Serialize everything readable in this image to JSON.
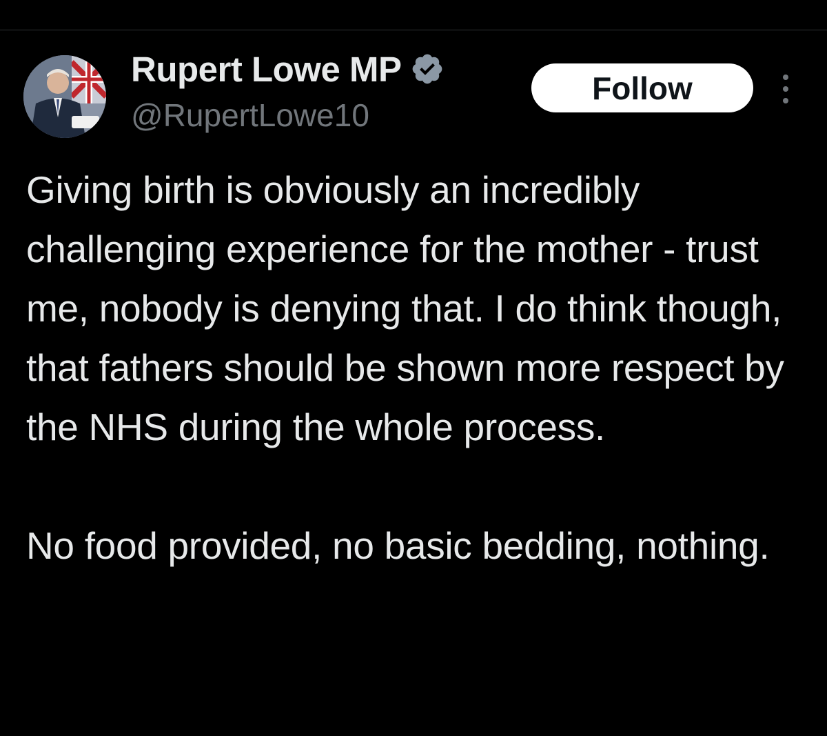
{
  "author": {
    "display_name": "Rupert Lowe MP",
    "handle": "@RupertLowe10",
    "verified": true,
    "verified_color": "#1d9bf0"
  },
  "actions": {
    "follow_label": "Follow",
    "more_icon": "more-vertical-icon"
  },
  "tweet": {
    "text": "Giving birth is obviously an incredibly challenging experience for the mother - trust me, nobody is denying that. I do think though, that fathers should be shown more respect by the NHS during the whole process.\n\nNo food provided, no basic bedding, nothing."
  },
  "theme": {
    "background": "#000000",
    "text_primary": "#e7e9ea",
    "text_secondary": "#71767b"
  }
}
